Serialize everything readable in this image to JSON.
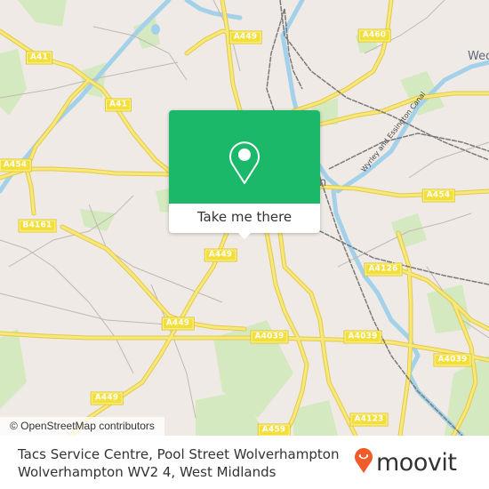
{
  "map": {
    "attribution": "© OpenStreetMap contributors",
    "road_labels": [
      {
        "id": "a41-1",
        "text": "A41"
      },
      {
        "id": "a41-2",
        "text": "A41"
      },
      {
        "id": "a454-w",
        "text": "A454"
      },
      {
        "id": "a449-n",
        "text": "A449"
      },
      {
        "id": "a460",
        "text": "A460"
      },
      {
        "id": "a454-e",
        "text": "A454"
      },
      {
        "id": "b4161",
        "text": "B4161"
      },
      {
        "id": "a449-c",
        "text": "A449"
      },
      {
        "id": "a449-sw",
        "text": "A449"
      },
      {
        "id": "a449-s",
        "text": "A449"
      },
      {
        "id": "a4126",
        "text": "A4126"
      },
      {
        "id": "a4039-1",
        "text": "A4039"
      },
      {
        "id": "a4039-2",
        "text": "A4039"
      },
      {
        "id": "a4039-3",
        "text": "A4039"
      },
      {
        "id": "a459",
        "text": "A459"
      },
      {
        "id": "a4123",
        "text": "A4123"
      }
    ],
    "place_labels": [
      {
        "id": "wednesfield",
        "text": "Wed"
      },
      {
        "id": "city-centre-partial",
        "text": "n"
      }
    ],
    "canal_label": "Wyrley and Essington Canal",
    "colors": {
      "land": "#efeae6",
      "park": "#cfe8b4",
      "water": "#a3d1ea",
      "road_major": "#f4e06a",
      "road_casing": "#e4c94a",
      "rail": "#777777"
    }
  },
  "popup": {
    "icon": "map-pin-icon",
    "button_label": "Take me there",
    "accent": "#1cb86a"
  },
  "footer": {
    "address_line1": "Tacs Service Centre, Pool Street Wolverhampton",
    "address_line2": "Wolverhampton WV2 4, West Midlands",
    "brand": "moovit",
    "brand_color": "#f15a29"
  }
}
